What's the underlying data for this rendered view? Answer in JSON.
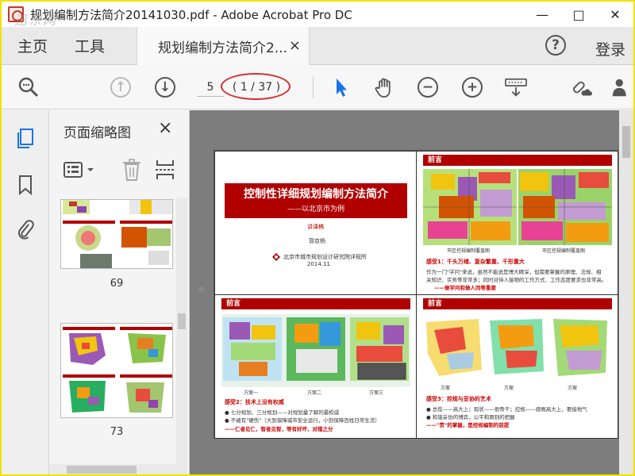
{
  "window": {
    "title": "规划编制方法简介20141030.pdf - Adobe Acrobat Pro DC",
    "watermark": "迅东网",
    "controls": [
      "—",
      "□",
      "✕"
    ]
  },
  "menu": {
    "home": "主页",
    "tools": "工具",
    "doc_tab_label": "规划编制方法简介2...",
    "tab_close": "×",
    "help": "?",
    "login": "登录"
  },
  "toolbar": {
    "current_page": "5",
    "page_count": "( 1 / 37 )",
    "icons": [
      "zoom-search-icon",
      "page-up-icon",
      "page-down-icon",
      "select-arrow-icon",
      "hand-icon",
      "zoom-out-icon",
      "zoom-in-icon",
      "keyboard-icon",
      "link-cloud-icon",
      "add-user-icon"
    ],
    "accent": "#1a73e8",
    "highlight_color": "#d32f2f"
  },
  "rail": {
    "icons": [
      "thumbnails-icon",
      "bookmark-icon",
      "attachment-icon"
    ]
  },
  "thumbnails": {
    "title": "页面缩略图",
    "close": "×",
    "pages": [
      {
        "label": "69"
      },
      {
        "label": "73"
      }
    ]
  },
  "document": {
    "slide1": {
      "title": "控制性详细规划编制方法简介",
      "subtitle": "——以北京市为例",
      "tag": "讲课稿",
      "author": "郭京杨",
      "org": "北京市城市规划设计研究院详规所",
      "date": "2014.11"
    },
    "slide2": {
      "header": "前言",
      "caption_left": "市区控规编制覆盖图",
      "caption_right": "市区控规编制覆盖图",
      "point": "感受1：千头万绪、复杂繁重、千形重大",
      "line1": "作为一门\"学问\"来说，虽然不能说是博大精深，但需要掌握的原理、法规、相",
      "line2": "关知识、实务等非常多；同时对待人接物的工作方式、工作态度要求也非常高。",
      "line3": "——做学问和做人同等重要"
    },
    "slide3": {
      "header": "前言",
      "captions": [
        "方案一",
        "方案二",
        "方案三"
      ],
      "point": "感受2：技术上没有权威",
      "line1": "● 七分规划、三分规划——对规划量了解的最权威",
      "line2": "● 不被有\"硬伤\"（大到保障城市安全运行，小到保障百姓日常生活）",
      "line3": "——仁者见仁，智者见智，等有好坏、对错之分"
    },
    "slide4": {
      "header": "前言",
      "captions": [
        "方案",
        "方案",
        "方案"
      ],
      "point": "感受3：控规与妥协的艺术",
      "line1": "● 总揽——高大上；现状——很骨干；控规——感慨高大上，要接地气",
      "line2": "● 和谐妥协的博弈，公平和原则的把握",
      "line3": "——\"责\"的掌握，是控规编制的前提"
    }
  }
}
